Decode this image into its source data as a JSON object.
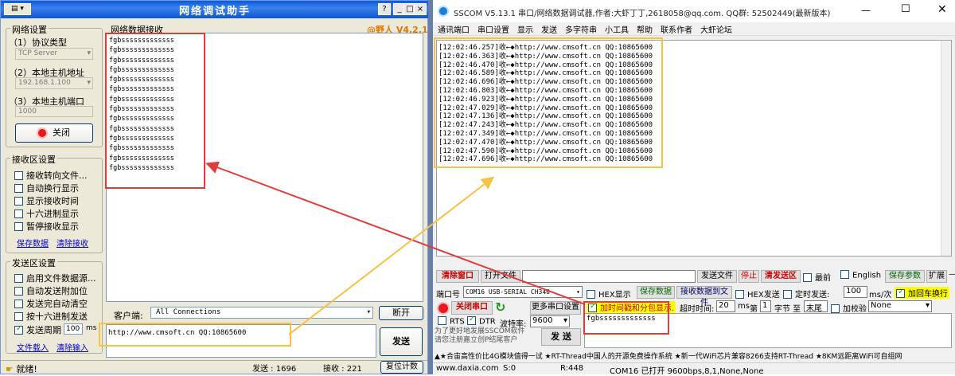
{
  "left": {
    "window_title": "网络调试助手",
    "net_settings": {
      "title": "网络设置",
      "protocol_label": "（1）协议类型",
      "protocol_value": "TCP Server",
      "host_label": "（2）本地主机地址",
      "host_value": "192.168.1.100",
      "port_label": "（3）本地主机端口",
      "port_value": "1000",
      "close_button": "关闭"
    },
    "recv_settings": {
      "title": "接收区设置",
      "options": [
        "接收转向文件...",
        "自动换行显示",
        "显示接收时间",
        "十六进制显示",
        "暂停接收显示"
      ],
      "save_link": "保存数据",
      "clear_link": "清除接收"
    },
    "send_settings": {
      "title": "发送区设置",
      "options": [
        "启用文件数据源...",
        "自动发送附加位",
        "发送完自动清空",
        "按十六进制发送",
        "发送周期"
      ],
      "period_value": "100",
      "period_unit": "ms",
      "load_link": "文件载入",
      "clear_link": "清除输入"
    },
    "recv_area_label": "网络数据接收",
    "brand": "@野人 V4.2.1",
    "recv_lines": [
      "fgbsssssssssssss",
      "fgbsssssssssssss",
      "fgbsssssssssssss",
      "fgbsssssssssssss",
      "fgbsssssssssssss",
      "fgbsssssssssssss",
      "fgbsssssssssssss",
      "fgbsssssssssssss",
      "fgbsssssssssssss",
      "fgbsssssssssssss",
      "fgbsssssssssssss",
      "fgbsssssssssssss",
      "fgbsssssssssssss",
      "fgbsssssssssssss"
    ],
    "client_label": "客户端:",
    "client_value": "All Connections",
    "disconnect_button": "断开",
    "send_text": "http://www.cmsoft.cn QQ:10865600",
    "send_button": "发送",
    "status": {
      "ready": "就绪!",
      "sent_label": "发送 : 1696",
      "recv_label": "接收 : 221",
      "reset_button": "复位计数"
    }
  },
  "right": {
    "window_title": "SSCOM V5.13.1 串口/网络数据调试器,作者:大虾丁丁,2618058@qq.com. QQ群: 52502449(最新版本)",
    "menu": [
      "通讯端口",
      "串口设置",
      "显示",
      "发送",
      "多字符串",
      "小工具",
      "帮助",
      "联系作者",
      "大虾论坛"
    ],
    "log_lines": [
      "[12:02:46.257]收←◆http://www.cmsoft.cn QQ:10865600",
      "[12:02:46.363]收←◆http://www.cmsoft.cn QQ:10865600",
      "[12:02:46.470]收←◆http://www.cmsoft.cn QQ:10865600",
      "[12:02:46.589]收←◆http://www.cmsoft.cn QQ:10865600",
      "[12:02:46.696]收←◆http://www.cmsoft.cn QQ:10865600",
      "[12:02:46.803]收←◆http://www.cmsoft.cn QQ:10865600",
      "[12:02:46.923]收←◆http://www.cmsoft.cn QQ:10865600",
      "[12:02:47.029]收←◆http://www.cmsoft.cn QQ:10865600",
      "[12:02:47.136]收←◆http://www.cmsoft.cn QQ:10865600",
      "[12:02:47.243]收←◆http://www.cmsoft.cn QQ:10865600",
      "[12:02:47.349]收←◆http://www.cmsoft.cn QQ:10865600",
      "[12:02:47.470]收←◆http://www.cmsoft.cn QQ:10865600",
      "[12:02:47.590]收←◆http://www.cmsoft.cn QQ:10865600",
      "[12:02:47.696]收←◆http://www.cmsoft.cn QQ:10865600"
    ],
    "row1": {
      "clear_window": "清除窗口",
      "open_file": "打开文件",
      "send_file": "发送文件",
      "stop": "停止",
      "clear_send": "清发送区",
      "top": "最前",
      "english": "English",
      "save_params": "保存参数",
      "expand": "扩展"
    },
    "row2": {
      "port_label": "端口号",
      "port_value": "COM16 USB-SERIAL CH340",
      "hex_display": "HEX显示",
      "save_data": "保存数据",
      "recv_to_file": "接收数据到文件",
      "hex_send": "HEX发送",
      "timed_send": "定时发送:",
      "timed_value": "100",
      "timed_unit": "ms/次",
      "add_crlf": "加回车换行"
    },
    "row3": {
      "close_port": "关闭串口",
      "more_settings": "更多串口设置",
      "add_timestamp": "加时间戳和分包显示.",
      "timeout_label": "超时时间:",
      "timeout_value": "20",
      "timeout_unit": "ms",
      "nth": "第",
      "nth_value": "1",
      "byte_to": "字节 至",
      "end": "末尾",
      "checksum": "加校验",
      "checksum_value": "None"
    },
    "row4": {
      "rts": "RTS",
      "dtr": "DTR",
      "baud_label": "波特率:",
      "baud_value": "9600",
      "send_button": "发 送",
      "send_text": "fgbsssssssssssss"
    },
    "promo": "为了更好地发展SSCOM软件\n请您注册嘉立创P结尾客户",
    "ticker": "▲★合宙高性价比4G模块值得一试 ★RT-Thread中国人的开源免费操作系统 ★新一代WiFi芯片兼容8266支持RT-Thread ★8KM远距离WiFi可自组网",
    "status": {
      "site": "www.daxia.com",
      "s": "S:0",
      "r": "R:448",
      "port_state": "COM16 已打开  9600bps,8,1,None,None"
    }
  }
}
